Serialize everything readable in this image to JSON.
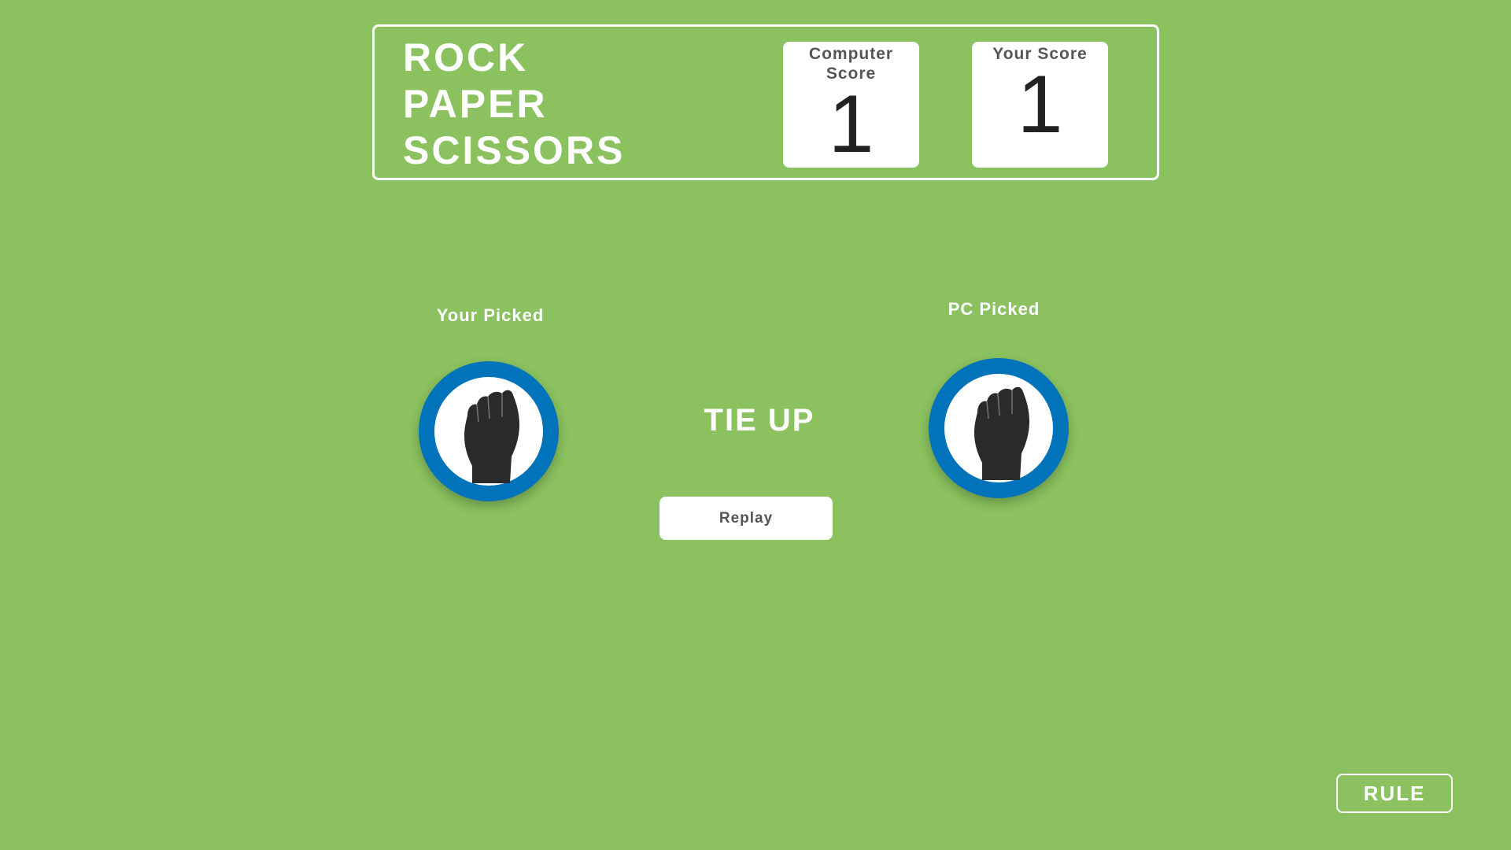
{
  "header": {
    "title_lines": [
      "ROCK",
      "PAPER",
      "SCISSORS"
    ],
    "computer_score_label": "Computer Score",
    "computer_score": "1",
    "your_score_label": "Your Score",
    "your_score": "1"
  },
  "game": {
    "your_pick_label": "Your Picked",
    "pc_pick_label": "PC Picked",
    "your_choice_icon": "rock-fist-icon",
    "pc_choice_icon": "rock-fist-icon",
    "result": "TIE UP",
    "replay_label": "Replay"
  },
  "footer": {
    "rule_label": "RULE"
  },
  "colors": {
    "background": "#8bc25f",
    "choice_ring": "#0073bb",
    "icon": "#2a2a2a"
  }
}
